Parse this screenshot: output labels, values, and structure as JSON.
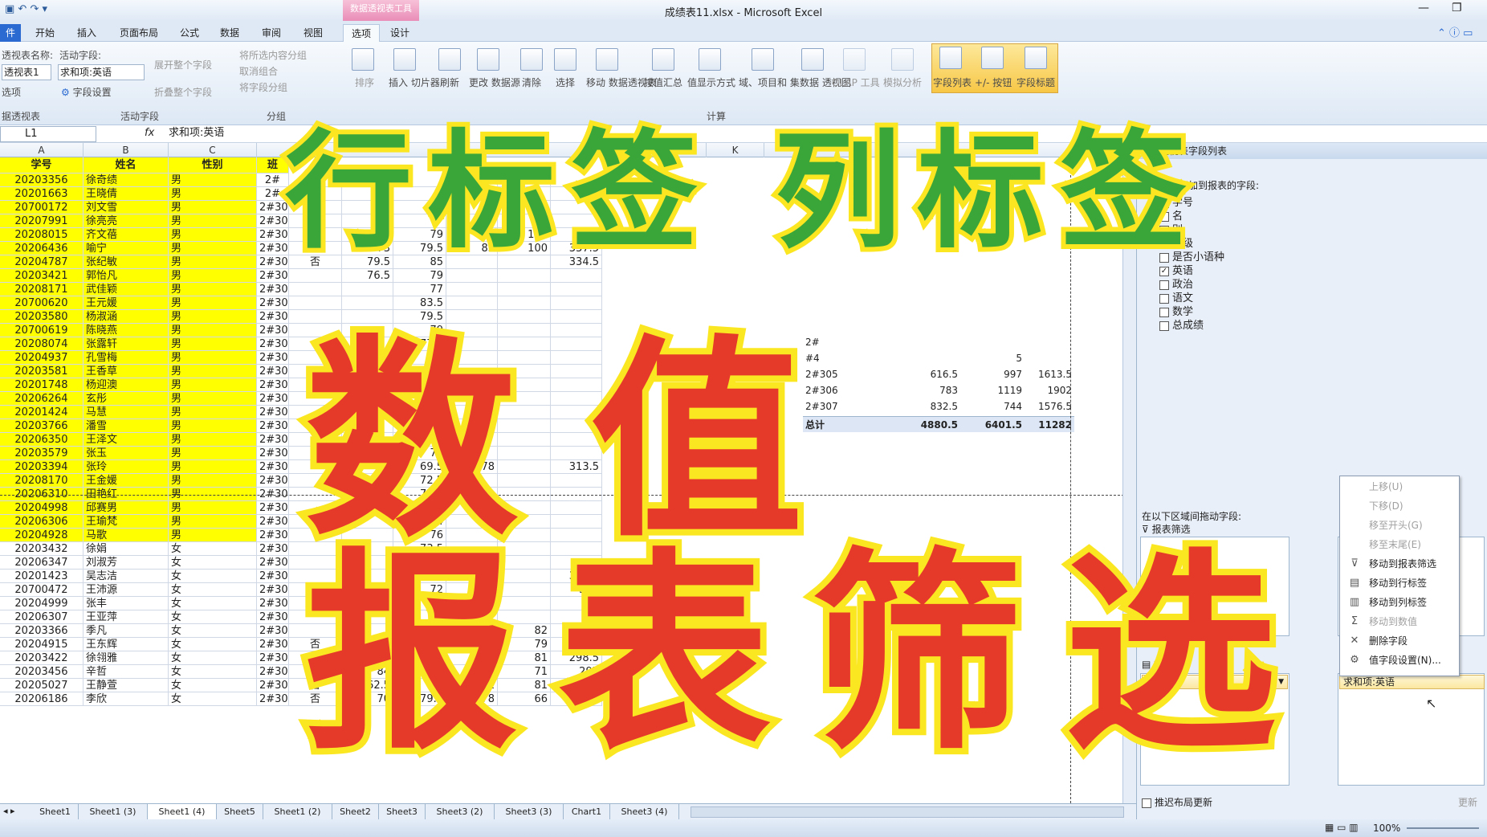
{
  "window": {
    "title": "成绩表11.xlsx - Microsoft Excel",
    "context_tab": "数据透视表工具"
  },
  "tabs": [
    "件",
    "开始",
    "插入",
    "页面布局",
    "公式",
    "数据",
    "审阅",
    "视图",
    "选项",
    "设计"
  ],
  "ribbon": {
    "pivot_name_label": "透视表名称:",
    "pivot_name_value": "透视表1",
    "options_label": "选项",
    "group_pivot": "据透视表",
    "active_field_label": "活动字段:",
    "active_field_value": "求和项:英语",
    "field_settings": "字段设置",
    "expand_field": "展开整个字段",
    "collapse_field": "折叠整个字段",
    "group_active_field": "活动字段",
    "group_selection": "将所选内容分组",
    "ungroup": "取消组合",
    "group_field": "将字段分组",
    "group_group": "分组",
    "sort": "排序",
    "insert_slicer": "插入\n切片器",
    "refresh": "刷新",
    "change_source": "更改\n数据源",
    "clear": "清除",
    "select": "选择",
    "move_pivot": "移动\n数据透视表",
    "summarize_by": "按值汇总",
    "show_values_as": "值显示方式",
    "fields_items": "域、项目和\n集",
    "pivot_chart": "数据\n透视图",
    "olap": "OLAP 工具",
    "what_if": "模拟分析",
    "field_list": "字段列表",
    "buttons": "+/- 按钮",
    "field_headers": "字段标题",
    "group_calc": "计算"
  },
  "formula_bar": {
    "name_box": "L1",
    "fx": "fx",
    "formula": "求和项:英语"
  },
  "columns": [
    "A",
    "B",
    "C",
    "K"
  ],
  "header_row": [
    "学号",
    "姓名",
    "性别",
    "班"
  ],
  "rows": [
    [
      "20203356",
      "徐奇绩",
      "男",
      "2#",
      "否",
      "",
      "",
      "",
      "",
      ""
    ],
    [
      "20201663",
      "王晓倩",
      "男",
      "2#",
      "否",
      "",
      "",
      "",
      "",
      ""
    ],
    [
      "20700172",
      "刘文雪",
      "男",
      "2#30",
      "",
      "",
      "",
      "",
      "",
      ""
    ],
    [
      "20207991",
      "徐亮亮",
      "男",
      "2#30",
      "",
      "80",
      "",
      "",
      "",
      ""
    ],
    [
      "20208015",
      "齐文蓓",
      "男",
      "2#302",
      "否",
      "79",
      "79",
      "81",
      "100",
      "339"
    ],
    [
      "20206436",
      "喻宁",
      "男",
      "2#306",
      "否",
      "73",
      "79.5",
      "85",
      "100",
      "337.5"
    ],
    [
      "20204787",
      "张纪敏",
      "男",
      "2#302",
      "否",
      "79.5",
      "85",
      "",
      "",
      "334.5"
    ],
    [
      "20203421",
      "郭怡凡",
      "男",
      "2#30",
      "",
      "76.5",
      "79",
      "",
      "",
      ""
    ],
    [
      "20208171",
      "武佳颖",
      "男",
      "2#306",
      "",
      "",
      "77",
      "",
      "",
      ""
    ],
    [
      "20700620",
      "王元媛",
      "男",
      "2#30",
      "",
      "",
      "83.5",
      "",
      "",
      ""
    ],
    [
      "20203580",
      "杨淑涵",
      "男",
      "2#30",
      "",
      "",
      "79.5",
      "",
      "",
      ""
    ],
    [
      "20700619",
      "陈晓燕",
      "男",
      "2#30",
      "",
      "",
      "79",
      "",
      "",
      ""
    ],
    [
      "20208074",
      "张露轩",
      "男",
      "2#304",
      "",
      "",
      "77.5",
      "",
      "",
      ""
    ],
    [
      "20204937",
      "孔雪梅",
      "男",
      "2#30",
      "",
      "",
      "72",
      "",
      "",
      ""
    ],
    [
      "20203581",
      "王香草",
      "男",
      "2#30",
      "",
      "",
      "80",
      "",
      "",
      ""
    ],
    [
      "20201748",
      "杨迎澳",
      "男",
      "2#30",
      "",
      "",
      "65",
      "",
      "",
      ""
    ],
    [
      "20206264",
      "玄彤",
      "男",
      "2#30",
      "",
      "",
      "79.5",
      "",
      "",
      ""
    ],
    [
      "20201424",
      "马慧",
      "男",
      "2#302",
      "",
      "",
      "72",
      "",
      "",
      ""
    ],
    [
      "20203766",
      "潘雪",
      "男",
      "2#304",
      "",
      "",
      "89",
      "",
      "",
      ""
    ],
    [
      "20206350",
      "王泽文",
      "男",
      "2#304",
      "",
      "",
      "82",
      "",
      "",
      ""
    ],
    [
      "20203579",
      "张玉",
      "男",
      "2#307",
      "",
      "",
      "77",
      "",
      "",
      ""
    ],
    [
      "20203394",
      "张玲",
      "男",
      "2#302",
      "",
      "",
      "69.5",
      "78",
      "",
      "313.5"
    ],
    [
      "20208170",
      "王金媛",
      "男",
      "2#30",
      "",
      "",
      "72.5",
      "",
      "",
      ""
    ],
    [
      "20206310",
      "田艳红",
      "男",
      "2#30",
      "",
      "",
      "77.5",
      "",
      "",
      ""
    ],
    [
      "20204998",
      "邱赛男",
      "男",
      "2#306",
      "",
      "",
      "77",
      "",
      "",
      ""
    ],
    [
      "20206306",
      "王瑜梵",
      "男",
      "2#303",
      "",
      "",
      "74",
      "",
      "",
      ""
    ],
    [
      "20204928",
      "马歌",
      "男",
      "2#305",
      "",
      "",
      "76",
      "",
      "",
      ""
    ],
    [
      "20203432",
      "徐娟",
      "女",
      "2#30",
      "",
      "",
      "73.5",
      "",
      "",
      ""
    ],
    [
      "20206347",
      "刘淑芳",
      "女",
      "2#304",
      "",
      "",
      "75",
      "76",
      "",
      ""
    ],
    [
      "20201423",
      "吴志洁",
      "女",
      "2#302",
      "",
      "",
      "65",
      "",
      "",
      "305.5"
    ],
    [
      "20700472",
      "王沛源",
      "女",
      "2#305",
      "",
      "",
      "72",
      "",
      "",
      "305"
    ],
    [
      "20204999",
      "张丰",
      "女",
      "2#306",
      "",
      "",
      "81",
      "",
      "",
      ""
    ],
    [
      "20206307",
      "王亚萍",
      "女",
      "2#30",
      "",
      "",
      "76",
      "",
      "",
      ""
    ],
    [
      "20203366",
      "季凡",
      "女",
      "2#30",
      "",
      "",
      "74",
      "66",
      "82",
      ""
    ],
    [
      "20204915",
      "王东辉",
      "女",
      "2#304",
      "否",
      "66.5",
      "79",
      "76",
      "79",
      "300"
    ],
    [
      "20203422",
      "徐翎雅",
      "女",
      "2#303",
      "否",
      "79.5",
      "62",
      "76",
      "81",
      "298.5"
    ],
    [
      "20203456",
      "辛哲",
      "女",
      "2#304",
      "否",
      "84",
      "64",
      "78",
      "71",
      "297"
    ],
    [
      "20205027",
      "王静萱",
      "女",
      "2#307",
      "否",
      "62.5",
      "71",
      "81",
      "81",
      "295.5"
    ],
    [
      "20206186",
      "李欣",
      "女",
      "2#307",
      "否",
      "70",
      "79.5",
      "78",
      "66",
      "293.5"
    ]
  ],
  "pivot_table": {
    "rows": [
      [
        "2#",
        "",
        "",
        ""
      ],
      [
        "#4",
        "",
        "5",
        ""
      ],
      [
        "2#305",
        "616.5",
        "997",
        "1613.5"
      ],
      [
        "2#306",
        "783",
        "1119",
        "1902"
      ],
      [
        "2#307",
        "832.5",
        "744",
        "1576.5"
      ]
    ],
    "total": [
      "总计",
      "4880.5",
      "6401.5",
      "11282"
    ]
  },
  "field_pane": {
    "title": "透视表字段列表",
    "choose_label": "择要添加到报表的字段:",
    "fields": [
      {
        "name": "学号",
        "checked": false
      },
      {
        "name": "名",
        "checked": false
      },
      {
        "name": "别",
        "checked": false
      },
      {
        "name": "班级",
        "checked": true
      },
      {
        "name": "是否小语种",
        "checked": false
      },
      {
        "name": "英语",
        "checked": true
      },
      {
        "name": "政治",
        "checked": false
      },
      {
        "name": "语文",
        "checked": false
      },
      {
        "name": "数学",
        "checked": false
      },
      {
        "name": "总成绩",
        "checked": false
      }
    ],
    "drag_label": "在以下区域间拖动字段:",
    "report_filter": "报表筛选",
    "row_labels": "行标签",
    "row_field": "班级",
    "value_field": "求和项:英语",
    "defer": "推迟布局更新",
    "update": "更新"
  },
  "context_menu": [
    {
      "label": "上移(U)",
      "disabled": true,
      "icon": ""
    },
    {
      "label": "下移(D)",
      "disabled": true,
      "icon": ""
    },
    {
      "label": "移至开头(G)",
      "disabled": true,
      "icon": ""
    },
    {
      "label": "移至末尾(E)",
      "disabled": true,
      "icon": ""
    },
    {
      "label": "移动到报表筛选",
      "disabled": false,
      "icon": "filter-icon"
    },
    {
      "label": "移动到行标签",
      "disabled": false,
      "icon": "rows-icon"
    },
    {
      "label": "移动到列标签",
      "disabled": false,
      "icon": "columns-icon"
    },
    {
      "label": "移动到数值",
      "disabled": true,
      "icon": "sigma-icon"
    },
    {
      "label": "删除字段",
      "disabled": false,
      "icon": "close-icon"
    },
    {
      "label": "值字段设置(N)...",
      "disabled": false,
      "icon": "settings-icon"
    }
  ],
  "sheet_tabs": [
    "Sheet1",
    "Sheet1 (3)",
    "Sheet1 (4)",
    "Sheet5",
    "Sheet1 (2)",
    "Sheet2",
    "Sheet3",
    "Sheet3 (2)",
    "Sheet3 (3)",
    "Chart1",
    "Sheet3 (4)"
  ],
  "status": {
    "zoom": "100%"
  },
  "overlay": {
    "line1": "行标签 列标签",
    "line2": "数值",
    "line3": "报表筛选"
  },
  "colors": {
    "highlight": "#ffff00",
    "overlay_green": "#3aa63a",
    "overlay_red": "#e53a2a",
    "overlay_outline": "#fbe622"
  }
}
